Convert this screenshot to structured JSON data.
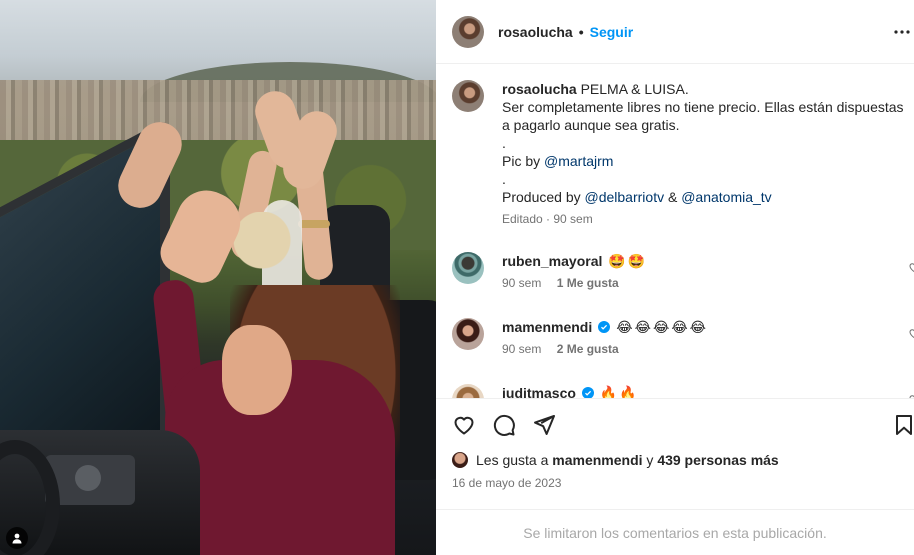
{
  "post": {
    "username": "rosaolucha",
    "dot": "•",
    "follow_label": "Seguir"
  },
  "caption": {
    "username": "rosaolucha",
    "line1": "PELMA & LUISA.",
    "line2": "Ser completamente libres no tiene precio. Ellas están dispuestas a pagarlo aunque sea gratis.",
    "sep1": ".",
    "pic_by_label": "Pic by",
    "pic_by_mention": "@martajrm",
    "sep2": ".",
    "produced_label": "Produced by",
    "produced_mention_1": "@delbarriotv",
    "amp": "&",
    "produced_mention_2": "@anatomia_tv",
    "meta": "Editado · 90 sem"
  },
  "comments": [
    {
      "username": "ruben_mayoral",
      "text": "🤩🤩",
      "verified": false,
      "time": "90 sem",
      "likes": "1 Me gusta"
    },
    {
      "username": "mamenmendi",
      "text": "😂😂😂😂😂",
      "verified": true,
      "time": "90 sem",
      "likes": "2 Me gusta"
    },
    {
      "username": "juditmasco",
      "text": "🔥🔥",
      "verified": true,
      "time": "",
      "likes": ""
    }
  ],
  "likes_summary": {
    "prefix": "Les gusta a",
    "user": "mamenmendi",
    "joiner": "y",
    "count": "439 personas más"
  },
  "date": "16 de mayo de 2023",
  "comments_limited": "Se limitaron los comentarios en esta publicación.",
  "icons": {
    "more": "more-horizontal-icon",
    "like": "heart-icon",
    "comment": "comment-bubble-icon",
    "share": "paper-plane-icon",
    "save": "bookmark-icon",
    "tag": "user-tag-icon"
  },
  "colors": {
    "link_blue": "#0095f6",
    "mention": "#00376b",
    "muted": "#737373",
    "verified": "#0095f6"
  }
}
